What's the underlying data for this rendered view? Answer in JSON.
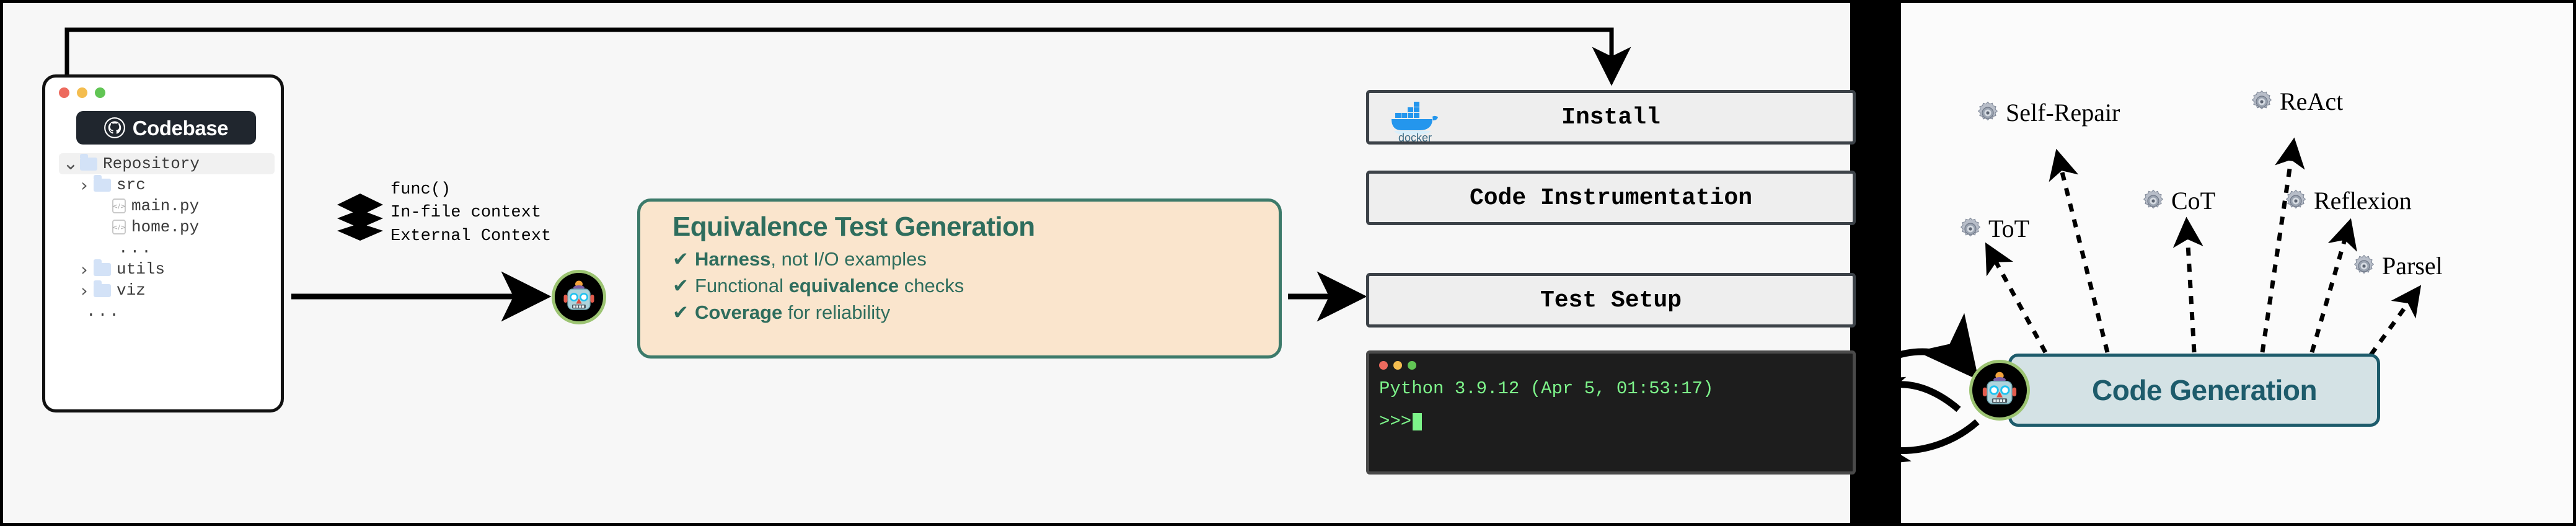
{
  "codebase": {
    "window_title": "Codebase",
    "github_icon": "github-icon",
    "traffic_lights": [
      "red",
      "yellow",
      "green"
    ],
    "tree": [
      {
        "indent": 0,
        "chevron": "v",
        "icon": "folder",
        "name": "Repository",
        "selected": true
      },
      {
        "indent": 1,
        "chevron": ">",
        "icon": "folder",
        "name": "src",
        "selected": false
      },
      {
        "indent": 2,
        "chevron": "",
        "icon": "file",
        "name": "main.py",
        "selected": false
      },
      {
        "indent": 2,
        "chevron": "",
        "icon": "file",
        "name": "home.py",
        "selected": false
      },
      {
        "indent": 2,
        "chevron": "",
        "icon": "none",
        "name": "...",
        "selected": false
      },
      {
        "indent": 1,
        "chevron": ">",
        "icon": "folder",
        "name": "utils",
        "selected": false
      },
      {
        "indent": 1,
        "chevron": ">",
        "icon": "folder",
        "name": "viz",
        "selected": false
      },
      {
        "indent": 0,
        "chevron": "",
        "icon": "none",
        "name": "...",
        "selected": false
      }
    ]
  },
  "context": {
    "stack_icon": "layers-stack-icon",
    "lines": [
      "func()",
      "In-file context",
      "External Context"
    ]
  },
  "equivalence": {
    "title": "Equivalence Test Generation",
    "check_glyph": "✔",
    "bullets": [
      {
        "strong": "Harness",
        "rest": ", not I/O examples",
        "pre": ""
      },
      {
        "strong": "equivalence",
        "rest": " checks",
        "pre": "Functional "
      },
      {
        "strong": "Coverage",
        "rest": " for reliability",
        "pre": ""
      }
    ],
    "robot_icon": "robot-avatar-icon",
    "border_color": "#3C7A6A",
    "fill_color": "#FAE5CD",
    "text_color": "#2E6D5D"
  },
  "pipeline": {
    "steps": [
      {
        "label": "Install",
        "icon": "docker-logo-icon"
      },
      {
        "label": "Code Instrumentation",
        "icon": ""
      },
      {
        "label": "Test Setup",
        "icon": ""
      }
    ]
  },
  "terminal": {
    "traffic_lights": [
      "red",
      "yellow",
      "green"
    ],
    "line1": "Python 3.9.12 (Apr 5, 01:53:17)",
    "prompt": ">>>",
    "text_color": "#7DF48A"
  },
  "codegen": {
    "label": "Code Generation",
    "robot_icon": "robot-avatar-icon",
    "fill_color": "#D4E2E5",
    "border_color": "#1D5B6B",
    "text_color": "#1D5B6B",
    "methods": [
      {
        "name": "Self-Repair",
        "icon": "gear-icon"
      },
      {
        "name": "ReAct",
        "icon": "gear-icon"
      },
      {
        "name": "ToT",
        "icon": "gear-icon"
      },
      {
        "name": "CoT",
        "icon": "gear-icon"
      },
      {
        "name": "Reflexion",
        "icon": "gear-icon"
      },
      {
        "name": "Parsel",
        "icon": "gear-icon"
      }
    ]
  }
}
